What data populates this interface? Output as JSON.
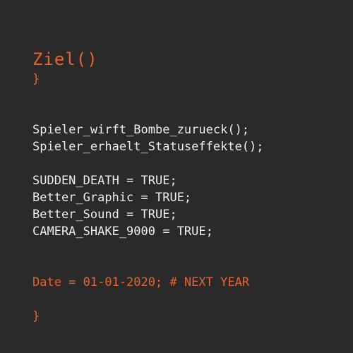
{
  "colors": {
    "background": "#2a2a2a",
    "text": "#ececec",
    "accent": "#e8622e"
  },
  "code": {
    "function_header": "Ziel()",
    "brace_open": "}",
    "call_1": "Spieler_wirft_Bombe_zurueck();",
    "call_2": "Spieler_erhaelt_Statuseffekte();",
    "assign_1": "SUDDEN_DEATH = TRUE;",
    "assign_2": "Better_Graphic = TRUE;",
    "assign_3": "Better_Sound = TRUE;",
    "assign_4": "CAMERA_SHAKE_9000 = TRUE;",
    "date_line": "Date = 01-01-2020; # NEXT YEAR",
    "brace_close": "}"
  }
}
